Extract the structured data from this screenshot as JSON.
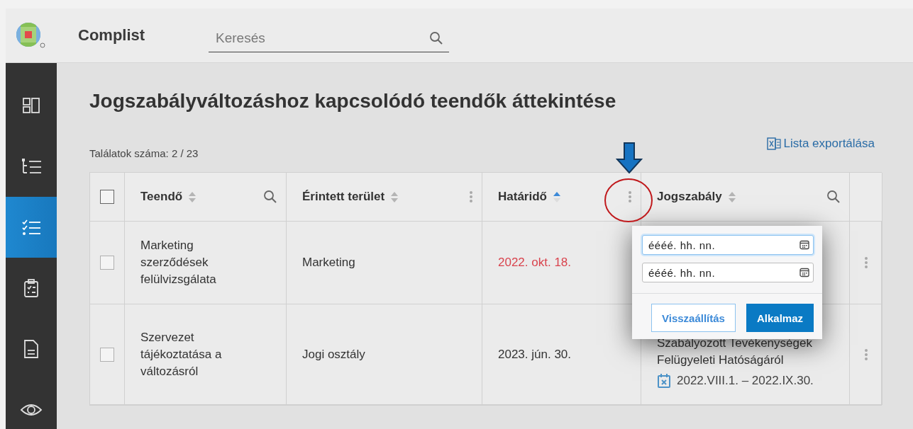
{
  "app": {
    "name": "Complist"
  },
  "search": {
    "placeholder": "Keresés"
  },
  "sidebar": {
    "items": [
      {
        "kind": "dashboard",
        "selected": false
      },
      {
        "kind": "tree",
        "selected": false
      },
      {
        "kind": "checklist",
        "selected": true
      },
      {
        "kind": "clipboard",
        "selected": false
      },
      {
        "kind": "document",
        "selected": false
      },
      {
        "kind": "eye",
        "selected": false
      }
    ]
  },
  "page": {
    "title": "Jogszabályváltozáshoz kapcsolódó teendők áttekintése",
    "result_count": "Találatok száma: 2 / 23",
    "export_link": "Lista exportálása"
  },
  "table": {
    "select_all_checked": false,
    "columns": [
      {
        "label": "Teendő",
        "sorted": false,
        "searchable": true
      },
      {
        "label": "Érintett terület",
        "sorted": false,
        "searchable": false
      },
      {
        "label": "Határidő",
        "sorted": true,
        "searchable": false
      },
      {
        "label": "Jogszabály",
        "sorted": false,
        "searchable": true
      }
    ],
    "rows": [
      {
        "checked": false,
        "task": "Marketing szerződések felülvizsgálata",
        "area": "Marketing",
        "deadline": "2022. okt. 18.",
        "overdue": true
      },
      {
        "checked": false,
        "task": "Szervezet tájékoztatása a változásról",
        "area": "Jogi osztály",
        "deadline": "2023. jún. 30.",
        "overdue": false,
        "regulation": "Szabályozott Tevékenységek Felügyeleti Hatóságáról",
        "period": "2022.VIII.1. – 2022.IX.30."
      }
    ]
  },
  "date_filter": {
    "fields": [
      {
        "placeholder": "éééé. hh. nn.",
        "focused": true
      },
      {
        "placeholder": "éééé. hh. nn.",
        "focused": false
      }
    ],
    "buttons": [
      {
        "label": "Visszaállítás",
        "kind": "secondary"
      },
      {
        "label": "Alkalmaz",
        "kind": "primary"
      }
    ]
  }
}
